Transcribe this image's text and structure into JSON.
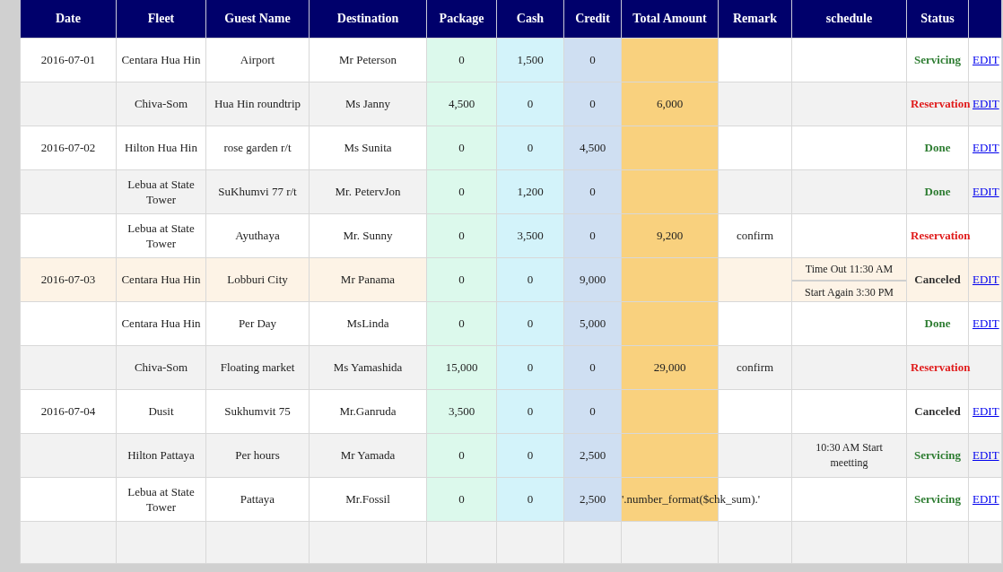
{
  "table": {
    "columns": [
      "Date",
      "Fleet",
      "Guest Name",
      "Destination",
      "Package",
      "Cash",
      "Credit",
      "Total Amount",
      "Remark",
      "schedule",
      "Status"
    ],
    "rows": [
      {
        "date": "2016-07-01",
        "fleet": "Centara Hua Hin",
        "guest_name": "Airport",
        "destination": "Mr Peterson",
        "package": "0",
        "cash": "1,500",
        "credit": "0",
        "status": {
          "text": "Servicing",
          "kind": "servicing"
        },
        "edit": "EDIT",
        "highlighted": false
      },
      {
        "fleet": "Chiva-Som",
        "guest_name": "Hua Hin roundtrip",
        "destination": "Ms Janny",
        "package": "4,500",
        "cash": "0",
        "credit": "0",
        "total_amount": "6,000",
        "status": {
          "text": "Reservation",
          "kind": "reservation"
        },
        "edit": "EDIT",
        "highlighted": false
      },
      {
        "date": "2016-07-02",
        "fleet": "Hilton Hua Hin",
        "guest_name": "rose garden r/t",
        "destination": "Ms Sunita",
        "package": "0",
        "cash": "0",
        "credit": "4,500",
        "status": {
          "text": "Done",
          "kind": "done"
        },
        "edit": "EDIT",
        "highlighted": false
      },
      {
        "fleet": "Lebua at State Tower",
        "guest_name": "SuKhumvi 77 r/t",
        "destination": "Mr. PetervJon",
        "package": "0",
        "cash": "1,200",
        "credit": "0",
        "status": {
          "text": "Done",
          "kind": "done"
        },
        "edit": "EDIT",
        "highlighted": false
      },
      {
        "fleet": "Lebua at State Tower",
        "guest_name": "Ayuthaya",
        "destination": "Mr. Sunny",
        "package": "0",
        "cash": "3,500",
        "credit": "0",
        "total_amount": "9,200",
        "remark": "confirm",
        "status": {
          "text": "Reservation",
          "kind": "reservation"
        },
        "highlighted": false
      },
      {
        "date": "2016-07-03",
        "fleet": "Centara Hua Hin",
        "guest_name": "Lobburi City",
        "destination": "Mr Panama",
        "package": "0",
        "cash": "0",
        "credit": "9,000",
        "schedule": [
          "Time Out 11:30 AM",
          "Start Again 3:30 PM"
        ],
        "status": {
          "text": "Canceled",
          "kind": "canceled"
        },
        "edit": "EDIT",
        "highlighted": true
      },
      {
        "fleet": "Centara Hua Hin",
        "guest_name": "Per Day",
        "destination": "MsLinda",
        "package": "0",
        "cash": "0",
        "credit": "5,000",
        "status": {
          "text": "Done",
          "kind": "done"
        },
        "edit": "EDIT",
        "highlighted": false
      },
      {
        "fleet": "Chiva-Som",
        "guest_name": "Floating market",
        "destination": "Ms Yamashida",
        "package": "15,000",
        "cash": "0",
        "credit": "0",
        "total_amount": "29,000",
        "remark": "confirm",
        "status": {
          "text": "Reservation",
          "kind": "reservation"
        },
        "highlighted": false
      },
      {
        "date": "2016-07-04",
        "fleet": "Dusit",
        "guest_name": "Sukhumvit 75",
        "destination": "Mr.Ganruda",
        "package": "3,500",
        "cash": "0",
        "credit": "0",
        "status": {
          "text": "Canceled",
          "kind": "canceled"
        },
        "edit": "EDIT",
        "highlighted": false
      },
      {
        "fleet": "Hilton Pattaya",
        "guest_name": "Per hours",
        "destination": "Mr Yamada",
        "package": "0",
        "cash": "0",
        "credit": "2,500",
        "schedule": [
          "10:30 AM Start meetting"
        ],
        "status": {
          "text": "Servicing",
          "kind": "servicing"
        },
        "edit": "EDIT",
        "highlighted": false
      },
      {
        "fleet": "Lebua at State Tower",
        "guest_name": "Pattaya",
        "destination": "Mr.Fossil",
        "package": "0",
        "cash": "0",
        "credit": "2,500",
        "total_amount": "'.number_format($chk_sum).'",
        "status": {
          "text": "Servicing",
          "kind": "servicing"
        },
        "edit": "EDIT",
        "highlighted": false
      }
    ]
  }
}
